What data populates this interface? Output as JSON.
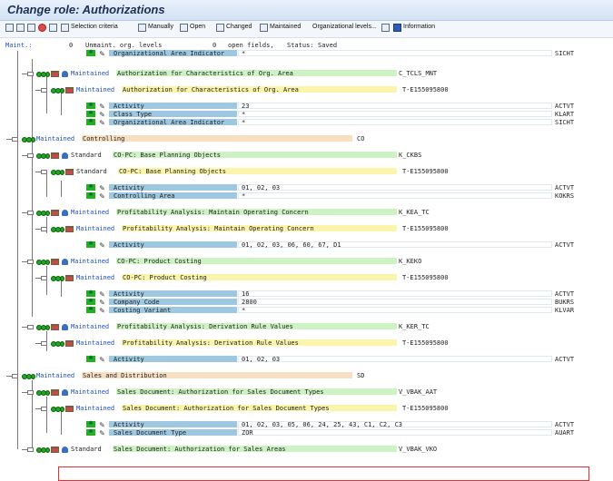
{
  "window": {
    "title": "Change role: Authorizations"
  },
  "toolbar": {
    "buttons": [
      {
        "label": "",
        "icon": "expand-icon"
      },
      {
        "label": "",
        "icon": "collapse-icon"
      },
      {
        "label": "",
        "icon": "save-icon"
      },
      {
        "label": "",
        "icon": "stop-icon"
      },
      {
        "label": "",
        "icon": "delete-icon"
      },
      {
        "label": "Selection criteria",
        "icon": "selection-icon"
      },
      {
        "label": "Manually",
        "icon": "manual-icon"
      },
      {
        "label": "Open",
        "icon": "open-icon"
      },
      {
        "label": "Changed",
        "icon": "changed-icon"
      },
      {
        "label": "Maintained",
        "icon": "maintained-icon"
      },
      {
        "label": "Organizational levels...",
        "icon": ""
      },
      {
        "label": "",
        "icon": "table-icon"
      },
      {
        "label": "Information",
        "icon": "info-icon"
      }
    ]
  },
  "header": {
    "maint": "Maint.:",
    "unmaint_count": "0",
    "unmaint_label": "Unmaint. org. levels",
    "open_count": "0",
    "open_label": "open fields,",
    "status_label": "Status:",
    "status_value": "Saved"
  },
  "colors": {
    "field_blue": "#9ec8e2",
    "green": "#cdf2c4",
    "yellow": "#fbf5ac",
    "orange": "#f9dfc2",
    "maintained_text": "#1d4fc1",
    "highlight_box": "#e03030"
  },
  "rows": [
    {
      "type": "field",
      "desc": "Organizational Area Indicator",
      "value": "*",
      "tech": "SICHT"
    },
    {
      "type": "object",
      "status": "Maintained",
      "desc": "Authorization for Characteristics of Org. Area",
      "tech": "C_TCLS_MNT"
    },
    {
      "type": "authorization",
      "status": "Maintained",
      "desc": "Authorization for Characteristics of Org. Area",
      "tech": "T-E155095800"
    },
    {
      "type": "field",
      "desc": "Activity",
      "value": "23",
      "tech": "ACTVT"
    },
    {
      "type": "field",
      "desc": "Class Type",
      "value": "*",
      "tech": "KLART"
    },
    {
      "type": "field",
      "desc": "Organizational Area Indicator",
      "value": "*",
      "tech": "SICHT"
    },
    {
      "type": "class",
      "status": "Maintained",
      "desc": "Controlling",
      "tech": "CO"
    },
    {
      "type": "object",
      "status": "Standard",
      "desc": "CO-PC: Base Planning Objects",
      "tech": "K_CKBS"
    },
    {
      "type": "authorization",
      "status": "Standard",
      "desc": "CO-PC: Base Planning Objects",
      "tech": "T-E155095800"
    },
    {
      "type": "field",
      "desc": "Activity",
      "value": "01, 02, 03",
      "tech": "ACTVT"
    },
    {
      "type": "field",
      "desc": "Controlling Area",
      "value": "*",
      "tech": "KOKRS"
    },
    {
      "type": "object",
      "status": "Maintained",
      "desc": "Profitability Analysis: Maintain Operating Concern",
      "tech": "K_KEA_TC"
    },
    {
      "type": "authorization",
      "status": "Maintained",
      "desc": "Profitability Analysis: Maintain Operating Concern",
      "tech": "T-E155095800"
    },
    {
      "type": "field",
      "desc": "Activity",
      "value": "01, 02, 03, 06, 60, 67, D1",
      "tech": "ACTVT"
    },
    {
      "type": "object",
      "status": "Maintained",
      "desc": "CO-PC: Product Costing",
      "tech": "K_KEKO"
    },
    {
      "type": "authorization",
      "status": "Maintained",
      "desc": "CO-PC: Product Costing",
      "tech": "T-E155095800"
    },
    {
      "type": "field",
      "desc": "Activity",
      "value": "16",
      "tech": "ACTVT"
    },
    {
      "type": "field",
      "desc": "Company Code",
      "value": "2800",
      "tech": "BUKRS"
    },
    {
      "type": "field",
      "desc": "Costing Variant",
      "value": "*",
      "tech": "KLVAR"
    },
    {
      "type": "object",
      "status": "Maintained",
      "desc": "Profitability Analysis: Derivation Rule Values",
      "tech": "K_KER_TC"
    },
    {
      "type": "authorization",
      "status": "Maintained",
      "desc": "Profitability Analysis: Derivation Rule Values",
      "tech": "T-E155095800"
    },
    {
      "type": "field",
      "desc": "Activity",
      "value": "01, 02, 03",
      "tech": "ACTVT"
    },
    {
      "type": "class",
      "status": "Maintained",
      "desc": "Sales and Distribution",
      "tech": "SD"
    },
    {
      "type": "object",
      "status": "Maintained",
      "desc": "Sales Document: Authorization for Sales Document Types",
      "tech": "V_VBAK_AAT"
    },
    {
      "type": "authorization",
      "status": "Maintained",
      "desc": "Sales Document: Authorization for Sales Document Types",
      "tech": "T-E155095800"
    },
    {
      "type": "field",
      "desc": "Activity",
      "value": "01, 02, 03, 05, 06, 24, 25, 43, C1, C2, C3",
      "tech": "ACTVT"
    },
    {
      "type": "field",
      "desc": "Sales Document Type",
      "value": "ZOR",
      "tech": "AUART"
    },
    {
      "type": "object",
      "status": "Standard",
      "desc": "Sales Document: Authorization for Sales Areas",
      "tech": "V_VBAK_VKO"
    }
  ]
}
